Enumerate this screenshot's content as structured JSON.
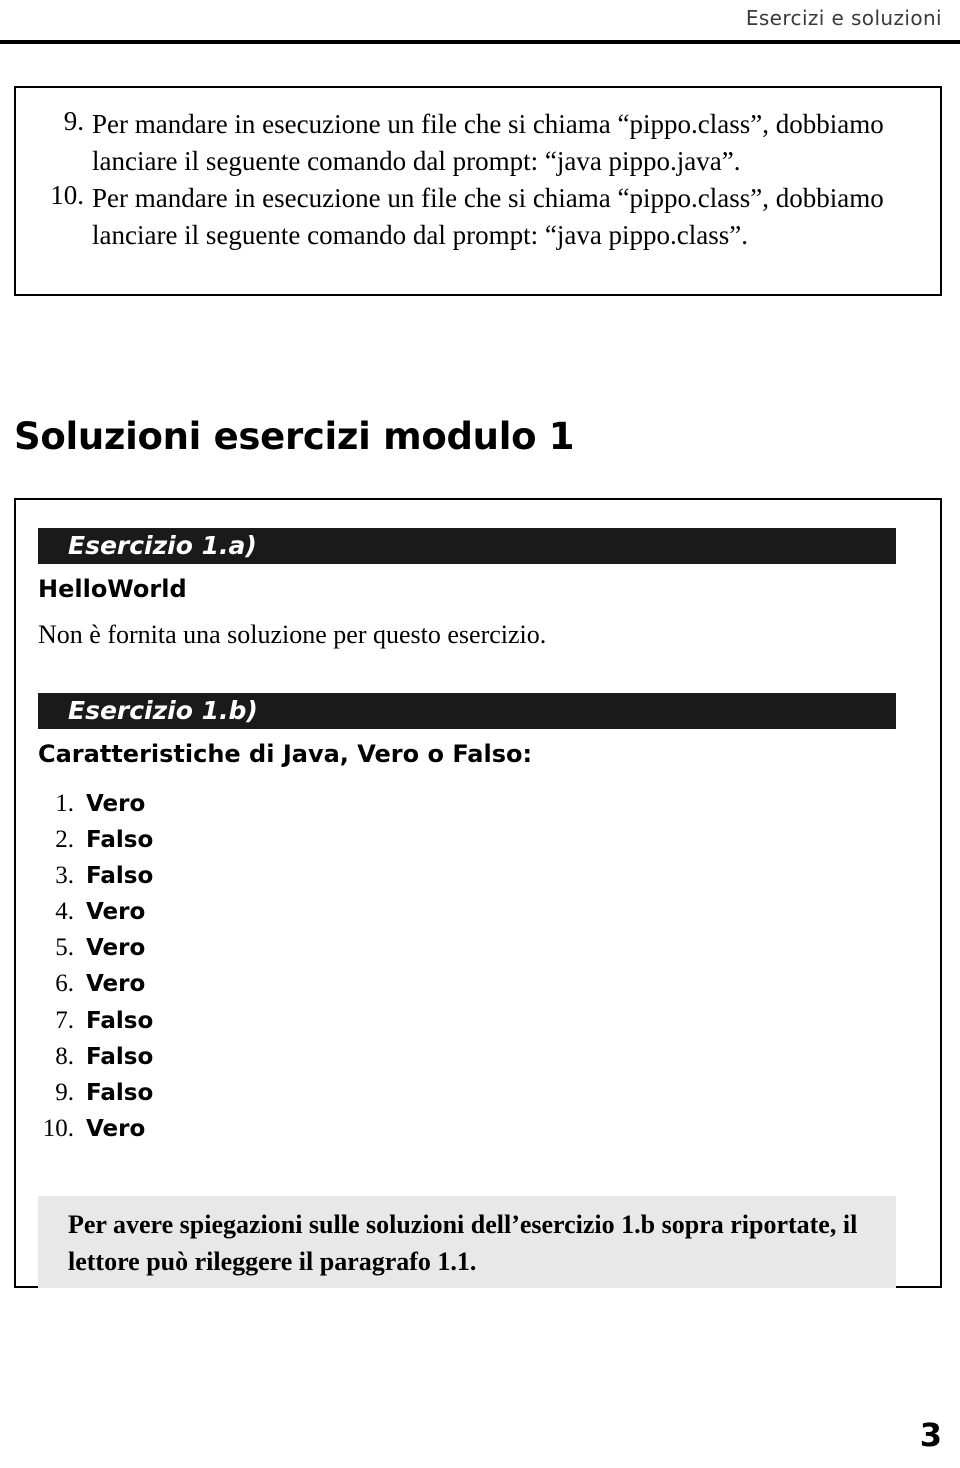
{
  "header": {
    "running_title": "Esercizi e soluzioni"
  },
  "top_box": {
    "items": [
      {
        "number": "9.",
        "line1": "Per mandare in esecuzione un file che si chiama “pippo.class”, dobbiamo",
        "line2": "lanciare il seguente comando dal prompt: “java pippo.java”."
      },
      {
        "number": "10.",
        "line1": "Per mandare in esecuzione un file che si chiama “pippo.class”, dobbiamo",
        "line2": "lanciare il seguente comando dal prompt: “java pippo.class”."
      }
    ]
  },
  "section": {
    "title": "Soluzioni esercizi modulo 1"
  },
  "exercise_a": {
    "banner": "Esercizio 1.a)",
    "subtitle": "HelloWorld",
    "body": "Non è fornita una soluzione per questo esercizio."
  },
  "exercise_b": {
    "banner": "Esercizio 1.b)",
    "subtitle": "Caratteristiche di Java, Vero o Falso:",
    "answers": [
      {
        "number": "1.",
        "value": "Vero"
      },
      {
        "number": "2.",
        "value": "Falso"
      },
      {
        "number": "3.",
        "value": "Falso"
      },
      {
        "number": "4.",
        "value": "Vero"
      },
      {
        "number": "5.",
        "value": "Vero"
      },
      {
        "number": "6.",
        "value": "Vero"
      },
      {
        "number": "7.",
        "value": "Falso"
      },
      {
        "number": "8.",
        "value": "Falso"
      },
      {
        "number": "9.",
        "value": "Falso"
      },
      {
        "number": "10.",
        "value": "Vero"
      }
    ]
  },
  "note": {
    "line1": "Per avere spiegazioni sulle soluzioni dell’esercizio 1.b sopra riportate, il",
    "line2": "lettore può rileggere il paragrafo 1.1."
  },
  "footer": {
    "page_number": "3"
  }
}
